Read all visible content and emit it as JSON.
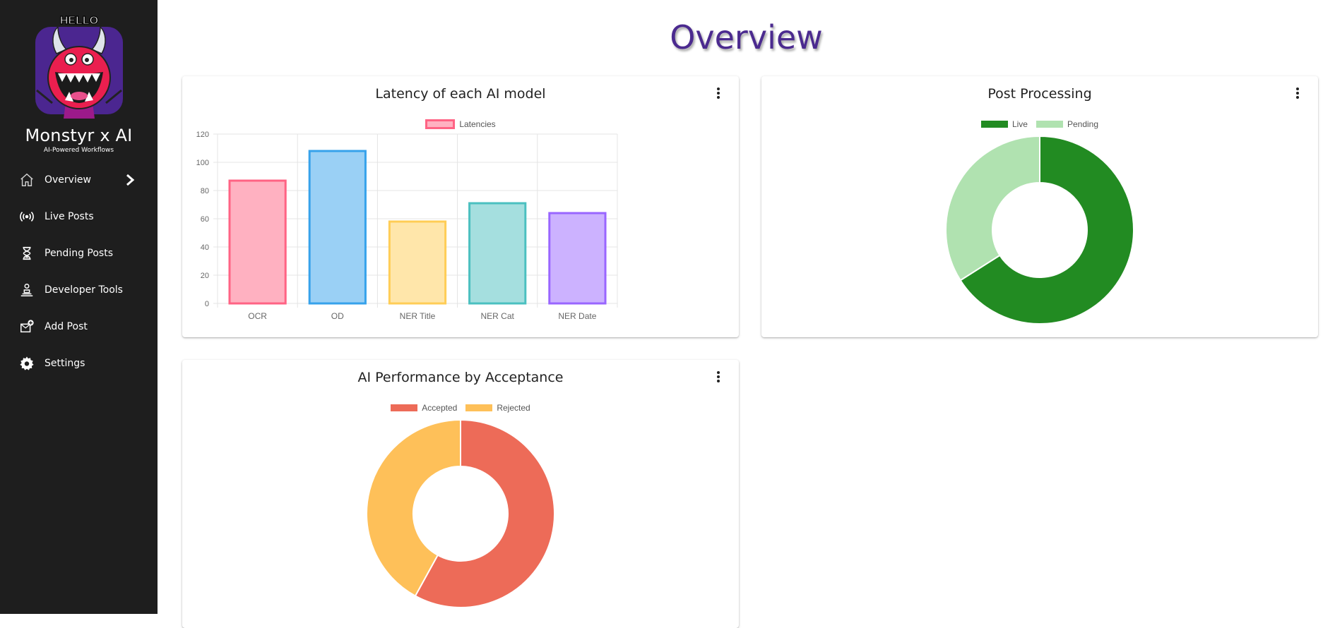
{
  "sidebar": {
    "logo_text": "HELLO",
    "brand_name": "Monstyr x AI",
    "brand_tagline": "AI-Powered Workflows",
    "items": [
      {
        "label": "Overview",
        "icon": "home-icon",
        "active": true
      },
      {
        "label": "Live Posts",
        "icon": "broadcast-icon"
      },
      {
        "label": "Pending Posts",
        "icon": "hourglass-icon"
      },
      {
        "label": "Developer Tools",
        "icon": "developer-tools-icon"
      },
      {
        "label": "Add Post",
        "icon": "add-post-icon"
      },
      {
        "label": "Settings",
        "icon": "gear-icon"
      }
    ]
  },
  "header": {
    "title": "Overview"
  },
  "colors": {
    "sidebar_bg": "#1e1e1e",
    "title": "#4b2a8f"
  },
  "cards": {
    "latency": {
      "title": "Latency of each AI model",
      "chart_data": {
        "type": "bar",
        "categories": [
          "OCR",
          "OD",
          "NER Title",
          "NER Cat",
          "NER Date"
        ],
        "series": [
          {
            "name": "Latencies",
            "values": [
              87,
              108,
              58,
              71,
              64
            ]
          }
        ],
        "colors": {
          "fill": [
            "#ffb1c1",
            "#9ad0f5",
            "#ffe6aa",
            "#a5dfdf",
            "#ccb2ff"
          ],
          "border": [
            "#ff6384",
            "#36a2eb",
            "#ffcd56",
            "#4bc0c0",
            "#9966ff"
          ]
        },
        "ylim": [
          0,
          120
        ],
        "yticks": [
          0,
          20,
          40,
          60,
          80,
          100,
          120
        ],
        "grid": true,
        "legend": "top"
      }
    },
    "post_processing": {
      "title": "Post Processing",
      "chart_data": {
        "type": "pie",
        "donut": true,
        "labels": [
          "Live",
          "Pending"
        ],
        "values": [
          66,
          34
        ],
        "colors": [
          "#228b22",
          "#b0e2b0"
        ],
        "legend": "top"
      }
    },
    "performance": {
      "title": "AI Performance by Acceptance",
      "chart_data": {
        "type": "pie",
        "donut": true,
        "labels": [
          "Accepted",
          "Rejected"
        ],
        "values": [
          58,
          42
        ],
        "colors": [
          "#ed6b58",
          "#fec059"
        ],
        "legend": "top"
      }
    }
  }
}
